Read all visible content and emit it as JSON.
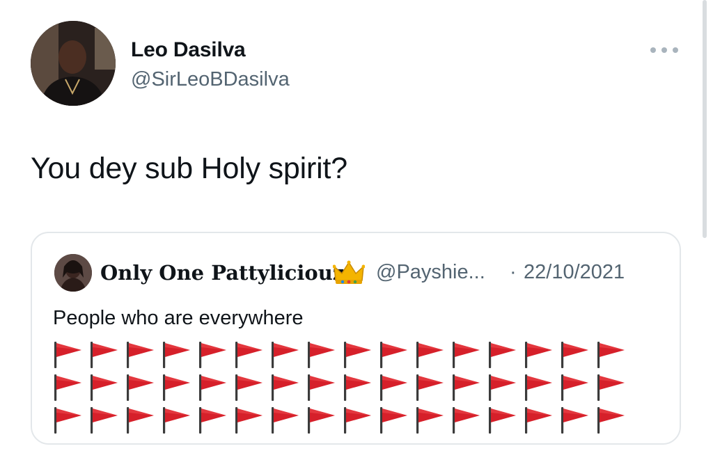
{
  "tweet": {
    "author": {
      "display_name": "Leo Dasilva",
      "handle": "@SirLeoBDasilva"
    },
    "text": "You dey sub Holy spirit?",
    "more_icon": "more-horizontal-icon",
    "quoted_tweet": {
      "display_name": "Only One Pattyliciouz",
      "name_emoji": "crown-icon",
      "handle": "@Payshie...",
      "separator": "·",
      "date": "22/10/2021",
      "text": "People who are everywhere",
      "flag_emoji": "triangular-flag-icon",
      "flag_rows": 3,
      "flags_per_row": 16
    }
  },
  "colors": {
    "text_primary": "#0f1419",
    "text_secondary": "#536471",
    "card_border": "#e3e7ea",
    "flag_red": "#d6202a"
  }
}
